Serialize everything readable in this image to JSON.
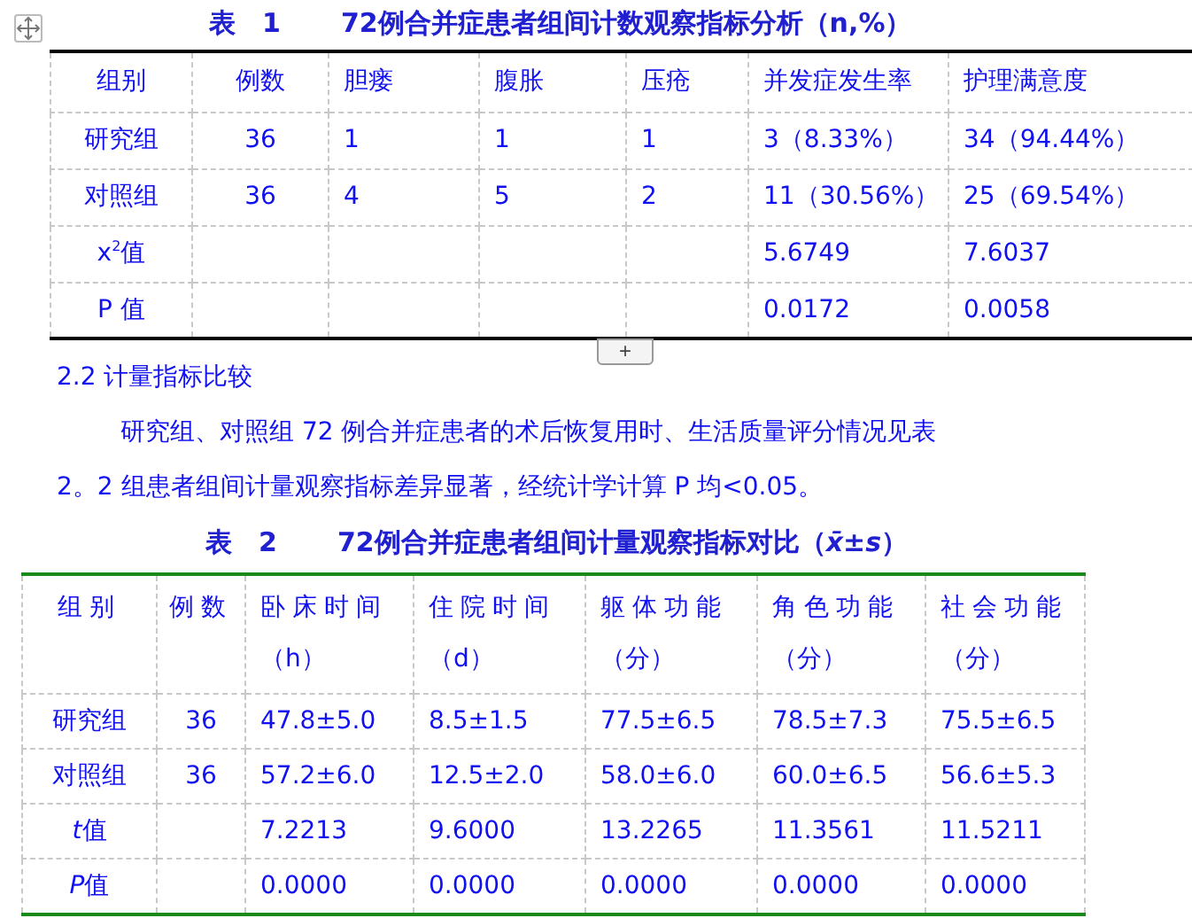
{
  "table1": {
    "label": "表　1",
    "title": "72例合并症患者组间计数观察指标分析（n,%）",
    "columns": [
      "组别",
      "例数",
      "胆瘘",
      "腹胀",
      "压疮",
      "并发症发生率",
      "护理满意度"
    ],
    "rows": [
      [
        "研究组",
        "36",
        "1",
        "1",
        "1",
        "3（8.33%）",
        "34（94.44%）"
      ],
      [
        "对照组",
        "36",
        "4",
        "5",
        "2",
        "11（30.56%）",
        "25（69.54%）"
      ],
      [
        "x$^{2}$值",
        "",
        "",
        "",
        "",
        "5.6749",
        "7.6037"
      ],
      [
        "P 值",
        "",
        "",
        "",
        "",
        "0.0172",
        "0.0058"
      ]
    ]
  },
  "expand_button": "+",
  "heading": "2.2 计量指标比较",
  "paragraph": "研究组、对照组 72 例合并症患者的术后恢复用时、生活质量评分情况见表",
  "paragraph_2": "2。2 组患者组间计量观察指标差异显著，经统计学计算 P 均<0.05。",
  "table2": {
    "label": "表　2",
    "title": "72例合并症患者组间计量观察指标对比（*x̄*±*s*）",
    "columns": [
      {
        "label": "组别"
      },
      {
        "label": "例数"
      },
      {
        "label": "卧床时间",
        "unit": "（h）"
      },
      {
        "label": "住院时间",
        "unit": "（d）"
      },
      {
        "label": "躯体功能",
        "unit": "（分）"
      },
      {
        "label": "角色功能",
        "unit": "（分）"
      },
      {
        "label": "社会功能",
        "unit": "（分）"
      }
    ],
    "rows": [
      [
        "研究组",
        "36",
        "47.8±5.0",
        "8.5±1.5",
        "77.5±6.5",
        "78.5±7.3",
        "75.5±6.5"
      ],
      [
        "对照组",
        "36",
        "57.2±6.0",
        "12.5±2.0",
        "58.0±6.0",
        "60.0±6.5",
        "56.6±5.3"
      ],
      [
        {
          "symbol": "t",
          "text": "值"
        },
        "",
        "7.2213",
        "9.6000",
        "13.2265",
        "11.3561",
        "11.5211"
      ],
      [
        {
          "symbol": "P",
          "text": "值"
        },
        "",
        "0.0000",
        "0.0000",
        "0.0000",
        "0.0000",
        "0.0000"
      ]
    ]
  }
}
